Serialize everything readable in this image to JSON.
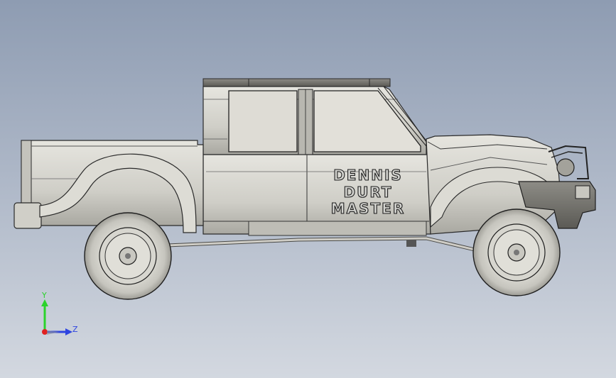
{
  "decal": {
    "line1": "DENNIS",
    "line2": "DURT",
    "line3": "MASTER"
  },
  "triad": {
    "y_label": "Y",
    "z_label": "Z",
    "y_color": "#2bd32b",
    "z_color": "#2d44e0",
    "x_color": "#e02020"
  },
  "colors": {
    "background_top": "#8e9cb2",
    "background_bottom": "#d3d8e0",
    "body": "#d4d3cc",
    "edges": "#2a2a2a"
  }
}
